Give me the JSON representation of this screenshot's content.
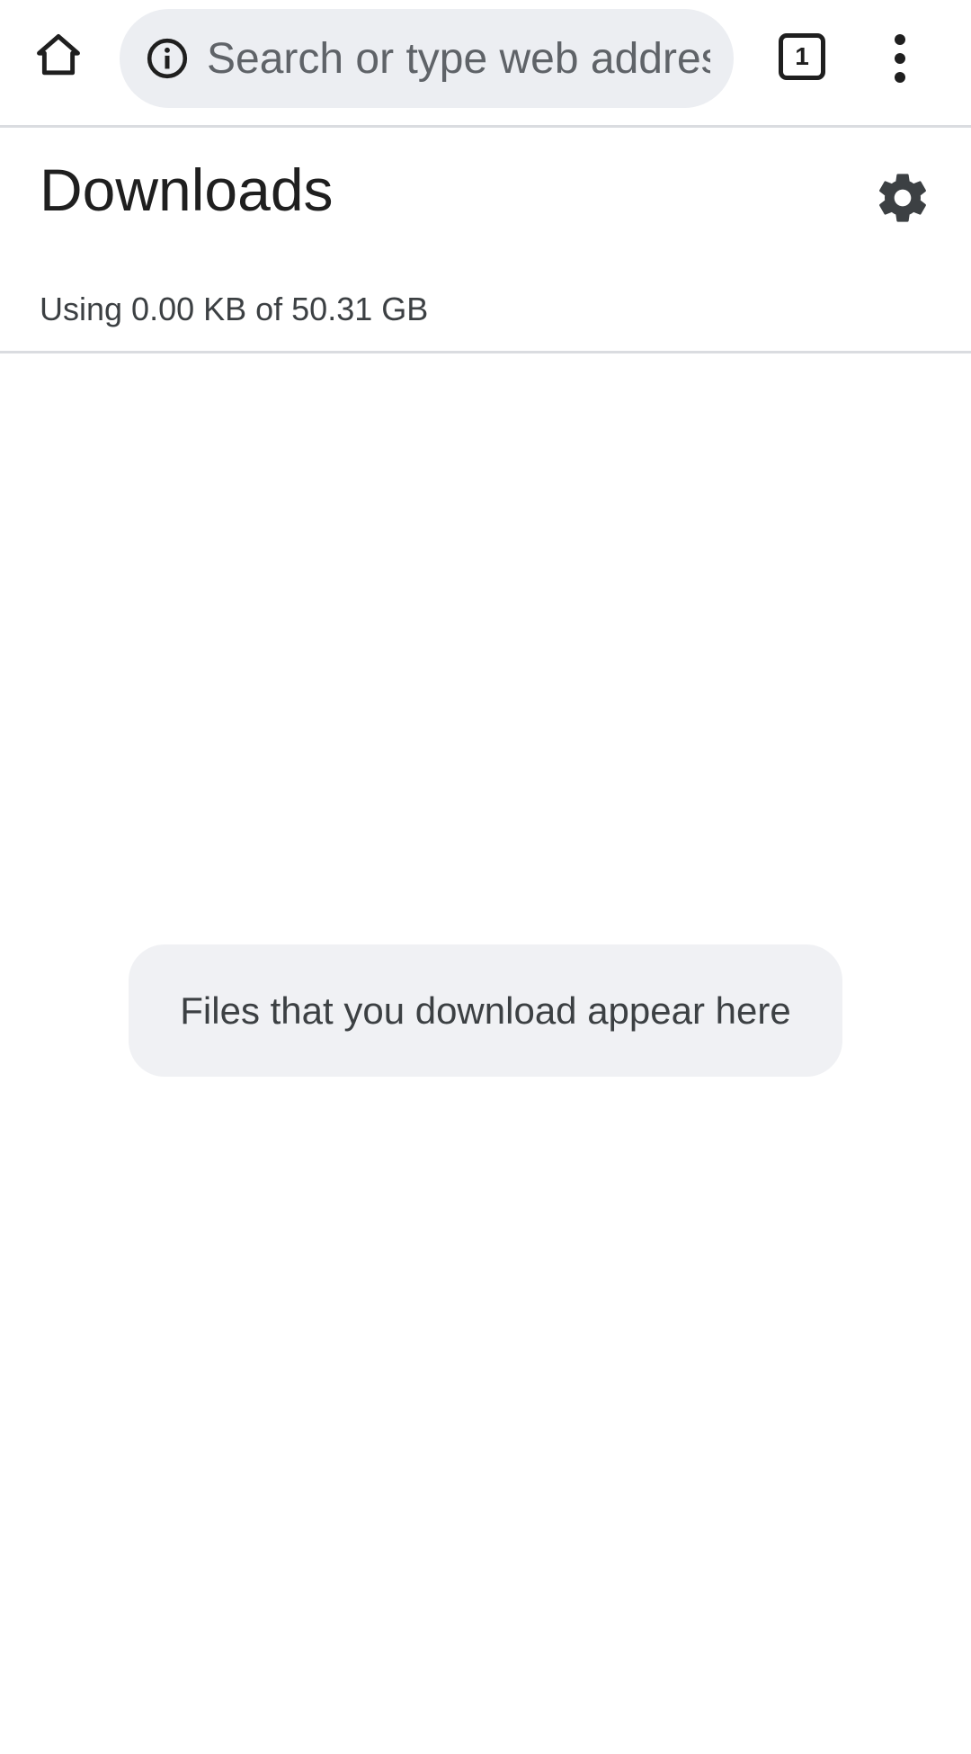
{
  "toolbar": {
    "home_icon": "home-icon",
    "omnibox": {
      "info_icon": "info-icon",
      "placeholder": "Search or type web address"
    },
    "tab_count": "1",
    "menu_icon": "more-vert-icon"
  },
  "header": {
    "title": "Downloads",
    "settings_icon": "gear-icon"
  },
  "storage": {
    "text": "Using 0.00 KB of 50.31 GB"
  },
  "empty_state": {
    "message": "Files that you download appear here"
  },
  "colors": {
    "omnibox_bg": "#eceef2",
    "card_bg": "#f0f1f4",
    "divider": "#dadce0",
    "text_primary": "#1f1f1f"
  }
}
